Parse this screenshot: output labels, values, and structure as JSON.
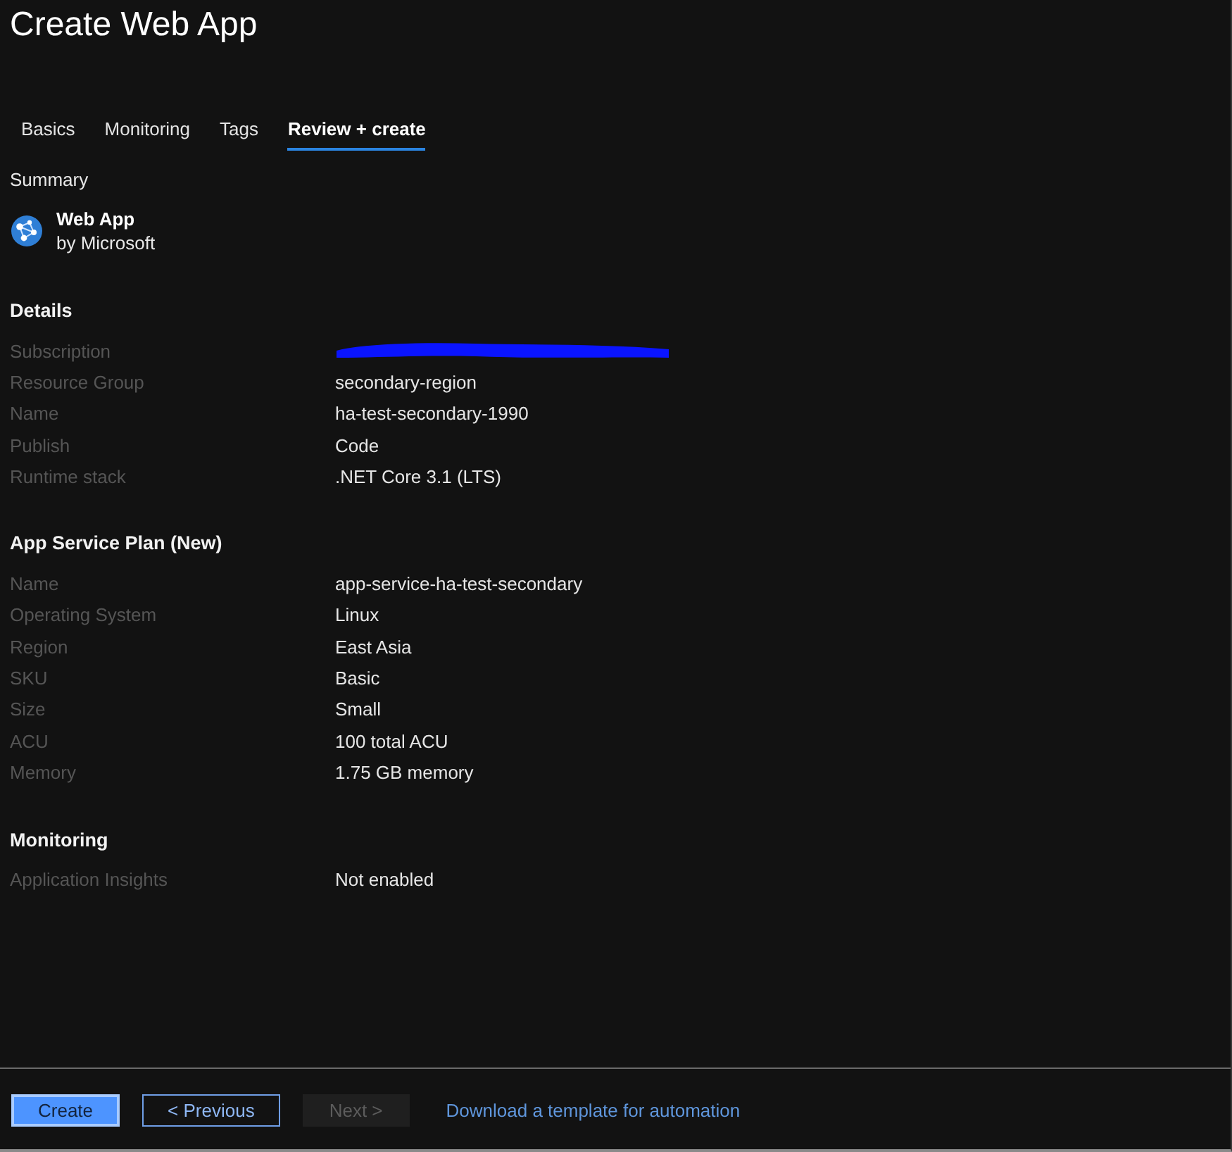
{
  "title": "Create Web App",
  "tabs": [
    {
      "label": "Basics",
      "selected": false
    },
    {
      "label": "Monitoring",
      "selected": false
    },
    {
      "label": "Tags",
      "selected": false
    },
    {
      "label": "Review + create",
      "selected": true
    }
  ],
  "summary": {
    "heading": "Summary",
    "product": "Web App",
    "publisher": "by Microsoft"
  },
  "sections": [
    {
      "heading": "Details",
      "rows": [
        {
          "label": "Subscription",
          "redacted": true
        },
        {
          "label": "Resource Group",
          "value": "secondary-region",
          "redacted": false
        },
        {
          "label": "Name",
          "value": "ha-test-secondary-1990",
          "redacted": false
        },
        {
          "label": "Publish",
          "value": "Code",
          "redacted": false
        },
        {
          "label": "Runtime stack",
          "value": ".NET Core 3.1 (LTS)",
          "redacted": false
        }
      ]
    },
    {
      "heading": "App Service Plan (New)",
      "rows": [
        {
          "label": "Name",
          "value": "app-service-ha-test-secondary",
          "redacted": false
        },
        {
          "label": "Operating System",
          "value": "Linux",
          "redacted": false
        },
        {
          "label": "Region",
          "value": "East Asia",
          "redacted": false
        },
        {
          "label": "SKU",
          "value": "Basic",
          "redacted": false
        },
        {
          "label": "Size",
          "value": "Small",
          "redacted": false
        },
        {
          "label": "ACU",
          "value": "100 total ACU",
          "redacted": false
        },
        {
          "label": "Memory",
          "value": "1.75 GB memory",
          "redacted": false
        }
      ]
    },
    {
      "heading": "Monitoring",
      "rows": [
        {
          "label": "Application Insights",
          "value": "Not enabled",
          "redacted": false
        }
      ]
    }
  ],
  "footer": {
    "buttons": [
      {
        "label": "Create",
        "kind": "primary",
        "disabled": false
      },
      {
        "label": "< Previous",
        "kind": "secondary",
        "disabled": false
      },
      {
        "label": "Next >",
        "kind": "secondary",
        "disabled": true
      }
    ],
    "link": "Download a template for automation"
  }
}
